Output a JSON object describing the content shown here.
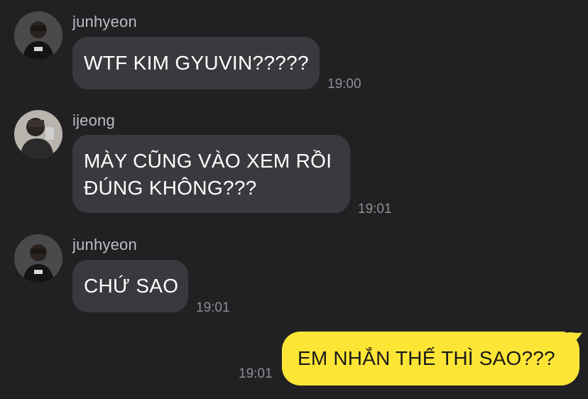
{
  "messages": [
    {
      "sender": "junhyeon",
      "avatar": "junhyeon-avatar",
      "lines": [
        "WTF KIM GYUVIN?????"
      ],
      "time": "19:00"
    },
    {
      "sender": "ijeong",
      "avatar": "ijeong-avatar",
      "lines": [
        "MÀY CŨNG VÀO XEM RỒI",
        "ĐÚNG KHÔNG???"
      ],
      "time": "19:01"
    },
    {
      "sender": "junhyeon",
      "avatar": "junhyeon-avatar",
      "lines": [
        "CHỨ SAO"
      ],
      "time": "19:01"
    }
  ],
  "outgoing": {
    "text": "EM NHẮN THẾ THÌ SAO???",
    "time": "19:01"
  },
  "colors": {
    "background": "#212124",
    "incoming_bubble": "#3a3a3e",
    "outgoing_bubble": "#fde535",
    "timestamp": "#8e8e93",
    "sender_name": "#bdbdc2"
  }
}
